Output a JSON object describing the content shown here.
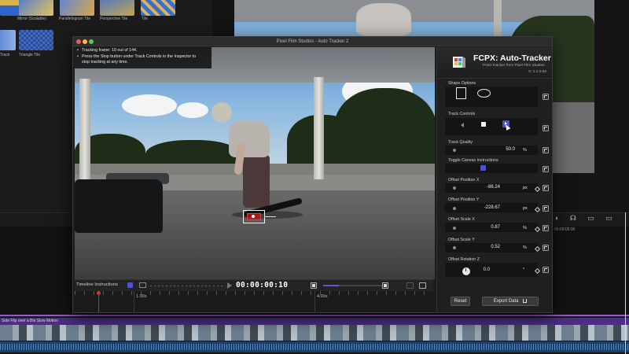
{
  "host": {
    "browser_tiles": [
      {
        "label": "",
        "colors": [
          "#d8b24a",
          "#2f64c8"
        ]
      },
      {
        "label": "Mirror (Scalable)",
        "colors": [
          "#4a7bd6",
          "#e5c25d"
        ]
      },
      {
        "label": "Parallelogram Tile",
        "colors": [
          "#5b86d8",
          "#d9a64a"
        ]
      },
      {
        "label": "Perspective Tile",
        "colors": [
          "#4275cf",
          "#c7a451"
        ]
      },
      {
        "label": "Tile",
        "colors": [
          "#3b6fd0",
          "#e0b355"
        ]
      },
      {
        "label": "Track",
        "colors": [
          "#2e5fc2",
          "#8fb0e8"
        ]
      },
      {
        "label": "Triangle Tile",
        "colors": [
          "#3c6bc8",
          "#2d4b8e"
        ]
      }
    ],
    "timecode_right": "00:00:05:00",
    "clip_title": "Side Flip over a Bin Slow Motion",
    "right_icons": "◖ ☊ ▭ ▭"
  },
  "window": {
    "title": "Pixel Film Studios - Auto Tracker 2",
    "traffic_lights": [
      "#ee5b55",
      "#f5bd3d",
      "#5fc453"
    ]
  },
  "instructions": {
    "lines": [
      "Tracking frame: 10 out of 144.",
      "Press the Stop button under Track Controls in the Inspector to",
      "stop tracking at any time."
    ]
  },
  "timeline": {
    "label": "Timeline Instructions",
    "timecode": "00:00:00:10",
    "ticks": [
      "1.00s",
      "4.00s"
    ]
  },
  "inspector": {
    "brand_title": "FCPX: Auto-Tracker",
    "brand_subtitle": "Point Tracker from Pixel Film Studios",
    "version": "V: 1.1.0.62",
    "sections": {
      "shape_options": "Shape Options",
      "track_controls": "Track Controls",
      "track_quality": "Track Quality",
      "toggle_canvas": "Toggle Canvas Instructions",
      "offset_x": "Offset Position X",
      "offset_y": "Offset Position Y",
      "scale_x": "Offset Scale X",
      "scale_y": "Offset Scale Y",
      "rotation_z": "Offset Rotation Z"
    },
    "values": {
      "track_quality": "50.0",
      "offset_x": "-86.24",
      "offset_y": "-228.67",
      "scale_x": "0.87",
      "scale_y": "0.52",
      "rotation_z": "0.0"
    },
    "units": {
      "percent": "%",
      "px": "px",
      "degree": "°"
    },
    "buttons": {
      "reset": "Reset",
      "export": "Export Data"
    }
  }
}
